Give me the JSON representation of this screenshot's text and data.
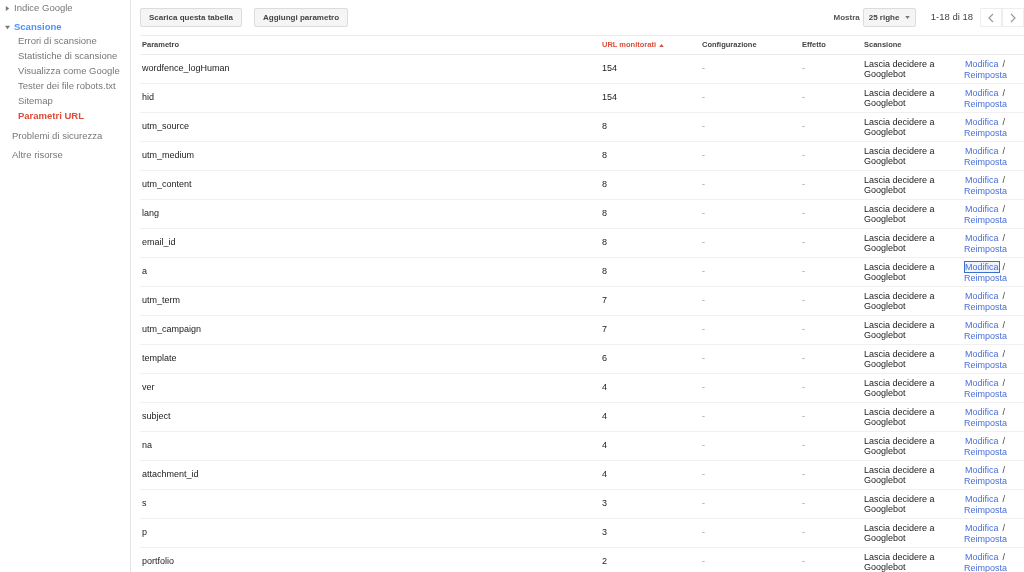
{
  "sidebar": {
    "items": [
      {
        "label": "Indice Google",
        "expanded": false,
        "selected": false
      },
      {
        "label": "Scansione",
        "expanded": true,
        "selected": false,
        "children": [
          {
            "label": "Errori di scansione",
            "selected": false
          },
          {
            "label": "Statistiche di scansione",
            "selected": false
          },
          {
            "label": "Visualizza come Google",
            "selected": false
          },
          {
            "label": "Tester dei file robots.txt",
            "selected": false
          },
          {
            "label": "Sitemap",
            "selected": false
          },
          {
            "label": "Parametri URL",
            "selected": true
          }
        ]
      },
      {
        "label": "Problemi di sicurezza",
        "selected": false
      },
      {
        "label": "Altre risorse",
        "selected": false
      }
    ]
  },
  "toolbar": {
    "buttons": [
      "Scarica questa tabella",
      "Aggiungi parametro"
    ],
    "show_label": "Mostra",
    "rows_select": "25 righe",
    "range": "1-18 di 18"
  },
  "table": {
    "columns": [
      {
        "label": "Parametro",
        "sorted": false
      },
      {
        "label": "URL monitorati",
        "sorted": true
      },
      {
        "label": "Configurazione",
        "sorted": false
      },
      {
        "label": "Effetto",
        "sorted": false
      },
      {
        "label": "Scansione",
        "sorted": false
      }
    ],
    "rows": [
      {
        "param": "wordfence_logHuman",
        "urls": "154",
        "config": "-",
        "effect": "-",
        "crawl": "Lascia decidere a Googlebot",
        "edit": "Modifica",
        "sep": "/",
        "reset": "Reimposta",
        "focused": false
      },
      {
        "param": "hid",
        "urls": "154",
        "config": "-",
        "effect": "-",
        "crawl": "Lascia decidere a Googlebot",
        "edit": "Modifica",
        "sep": "/",
        "reset": "Reimposta",
        "focused": false
      },
      {
        "param": "utm_source",
        "urls": "8",
        "config": "-",
        "effect": "-",
        "crawl": "Lascia decidere a Googlebot",
        "edit": "Modifica",
        "sep": "/",
        "reset": "Reimposta",
        "focused": false
      },
      {
        "param": "utm_medium",
        "urls": "8",
        "config": "-",
        "effect": "-",
        "crawl": "Lascia decidere a Googlebot",
        "edit": "Modifica",
        "sep": "/",
        "reset": "Reimposta",
        "focused": false
      },
      {
        "param": "utm_content",
        "urls": "8",
        "config": "-",
        "effect": "-",
        "crawl": "Lascia decidere a Googlebot",
        "edit": "Modifica",
        "sep": "/",
        "reset": "Reimposta",
        "focused": false
      },
      {
        "param": "lang",
        "urls": "8",
        "config": "-",
        "effect": "-",
        "crawl": "Lascia decidere a Googlebot",
        "edit": "Modifica",
        "sep": "/",
        "reset": "Reimposta",
        "focused": false
      },
      {
        "param": "email_id",
        "urls": "8",
        "config": "-",
        "effect": "-",
        "crawl": "Lascia decidere a Googlebot",
        "edit": "Modifica",
        "sep": "/",
        "reset": "Reimposta",
        "focused": false
      },
      {
        "param": "a",
        "urls": "8",
        "config": "-",
        "effect": "-",
        "crawl": "Lascia decidere a Googlebot",
        "edit": "Modifica",
        "sep": "/",
        "reset": "Reimposta",
        "focused": true
      },
      {
        "param": "utm_term",
        "urls": "7",
        "config": "-",
        "effect": "-",
        "crawl": "Lascia decidere a Googlebot",
        "edit": "Modifica",
        "sep": "/",
        "reset": "Reimposta",
        "focused": false
      },
      {
        "param": "utm_campaign",
        "urls": "7",
        "config": "-",
        "effect": "-",
        "crawl": "Lascia decidere a Googlebot",
        "edit": "Modifica",
        "sep": "/",
        "reset": "Reimposta",
        "focused": false
      },
      {
        "param": "template",
        "urls": "6",
        "config": "-",
        "effect": "-",
        "crawl": "Lascia decidere a Googlebot",
        "edit": "Modifica",
        "sep": "/",
        "reset": "Reimposta",
        "focused": false
      },
      {
        "param": "ver",
        "urls": "4",
        "config": "-",
        "effect": "-",
        "crawl": "Lascia decidere a Googlebot",
        "edit": "Modifica",
        "sep": "/",
        "reset": "Reimposta",
        "focused": false
      },
      {
        "param": "subject",
        "urls": "4",
        "config": "-",
        "effect": "-",
        "crawl": "Lascia decidere a Googlebot",
        "edit": "Modifica",
        "sep": "/",
        "reset": "Reimposta",
        "focused": false
      },
      {
        "param": "na",
        "urls": "4",
        "config": "-",
        "effect": "-",
        "crawl": "Lascia decidere a Googlebot",
        "edit": "Modifica",
        "sep": "/",
        "reset": "Reimposta",
        "focused": false
      },
      {
        "param": "attachment_id",
        "urls": "4",
        "config": "-",
        "effect": "-",
        "crawl": "Lascia decidere a Googlebot",
        "edit": "Modifica",
        "sep": "/",
        "reset": "Reimposta",
        "focused": false
      },
      {
        "param": "s",
        "urls": "3",
        "config": "-",
        "effect": "-",
        "crawl": "Lascia decidere a Googlebot",
        "edit": "Modifica",
        "sep": "/",
        "reset": "Reimposta",
        "focused": false
      },
      {
        "param": "p",
        "urls": "3",
        "config": "-",
        "effect": "-",
        "crawl": "Lascia decidere a Googlebot",
        "edit": "Modifica",
        "sep": "/",
        "reset": "Reimposta",
        "focused": false
      },
      {
        "param": "portfolio",
        "urls": "2",
        "config": "-",
        "effect": "-",
        "crawl": "Lascia decidere a Googlebot",
        "edit": "Modifica",
        "sep": "/",
        "reset": "Reimposta",
        "focused": false
      }
    ]
  }
}
